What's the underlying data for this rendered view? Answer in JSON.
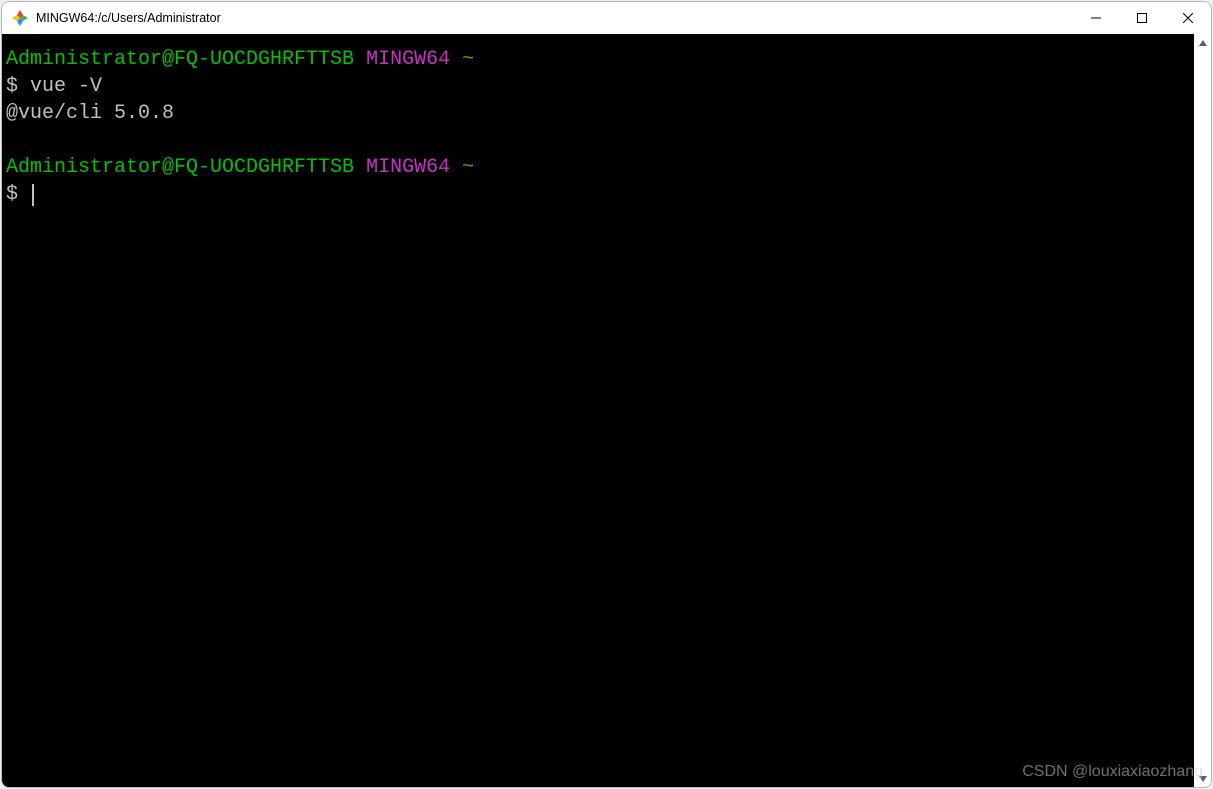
{
  "window": {
    "title": "MINGW64:/c/Users/Administrator"
  },
  "terminal": {
    "lines": [
      {
        "user_host": "Administrator@FQ-UOCDGHRFTTSB",
        "tag": "MINGW64",
        "path": "~"
      },
      {
        "prompt": "$",
        "command": "vue -V"
      },
      {
        "output": "@vue/cli 5.0.8"
      },
      {
        "blank": ""
      },
      {
        "user_host": "Administrator@FQ-UOCDGHRFTTSB",
        "tag": "MINGW64",
        "path": "~"
      },
      {
        "prompt": "$",
        "command": "",
        "cursor": true
      }
    ]
  },
  "watermark": "CSDN @louxiaxiaozhang"
}
